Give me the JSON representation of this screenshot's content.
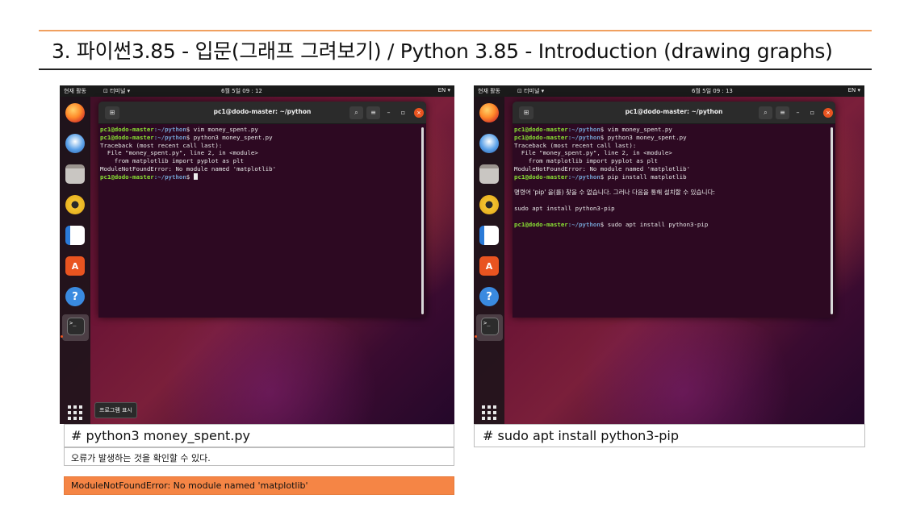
{
  "slide": {
    "title": "3. 파이썬3.85 - 입문(그래프 그려보기) / Python 3.85 - Introduction (drawing graphs)",
    "accent_color": "#f58545"
  },
  "screenshots": [
    {
      "topbar": {
        "activities": "현재 활동",
        "app_menu": "⊡ 터미널 ▾",
        "clock": "6월 5일 09 : 12",
        "lang": "EN ▾"
      },
      "dock": {
        "icons": [
          "firefox-icon",
          "thunderbird-icon",
          "files-icon",
          "rhythmbox-icon",
          "libreoffice-writer-icon",
          "software-center-icon",
          "help-icon",
          "terminal-icon",
          "show-applications-icon"
        ],
        "show_apps_tooltip": "프로그램 표시"
      },
      "terminal": {
        "title": "pc1@dodo-master: ~/python",
        "prompt_user": "pc1@dodo-master",
        "prompt_path": ":~/python",
        "lines": [
          {
            "type": "cmd",
            "text": "$ vim money_spent.py"
          },
          {
            "type": "cmd",
            "text": "$ python3 money_spent.py"
          },
          {
            "type": "out",
            "text": "Traceback (most recent call last):"
          },
          {
            "type": "out",
            "text": "  File \"money_spent.py\", line 2, in <module>"
          },
          {
            "type": "out",
            "text": "    from matplotlib import pyplot as plt"
          },
          {
            "type": "out",
            "text": "ModuleNotFoundError: No module named 'matplotlib'"
          },
          {
            "type": "cmd",
            "text": "$ "
          }
        ]
      },
      "captions": {
        "command": "# python3 money_spent.py",
        "note": "오류가 발생하는 것을 확인할 수 있다.",
        "error": "ModuleNotFoundError: No module named 'matplotlib'"
      }
    },
    {
      "topbar": {
        "activities": "현재 활동",
        "app_menu": "⊡ 터미널 ▾",
        "clock": "6월 5일 09 : 13",
        "lang": "EN ▾"
      },
      "terminal": {
        "title": "pc1@dodo-master: ~/python",
        "prompt_user": "pc1@dodo-master",
        "prompt_path": ":~/python",
        "lines": [
          {
            "type": "cmd",
            "text": "$ vim money_spent.py"
          },
          {
            "type": "cmd",
            "text": "$ python3 money_spent.py"
          },
          {
            "type": "out",
            "text": "Traceback (most recent call last):"
          },
          {
            "type": "out",
            "text": "  File \"money_spent.py\", line 2, in <module>"
          },
          {
            "type": "out",
            "text": "    from matplotlib import pyplot as plt"
          },
          {
            "type": "out",
            "text": "ModuleNotFoundError: No module named 'matplotlib'"
          },
          {
            "type": "cmd",
            "text": "$ pip install matplotlib"
          },
          {
            "type": "blank",
            "text": ""
          },
          {
            "type": "kr",
            "text": "명령어 'pip' 을(를) 찾을 수 없습니다. 그러나 다음을 통해 설치할 수 있습니다:"
          },
          {
            "type": "blank",
            "text": ""
          },
          {
            "type": "out",
            "text": "sudo apt install python3-pip"
          },
          {
            "type": "blank",
            "text": ""
          },
          {
            "type": "cmd",
            "text": "$ sudo apt install python3-pip"
          }
        ]
      },
      "captions": {
        "command": "# sudo apt install python3-pip"
      }
    }
  ]
}
